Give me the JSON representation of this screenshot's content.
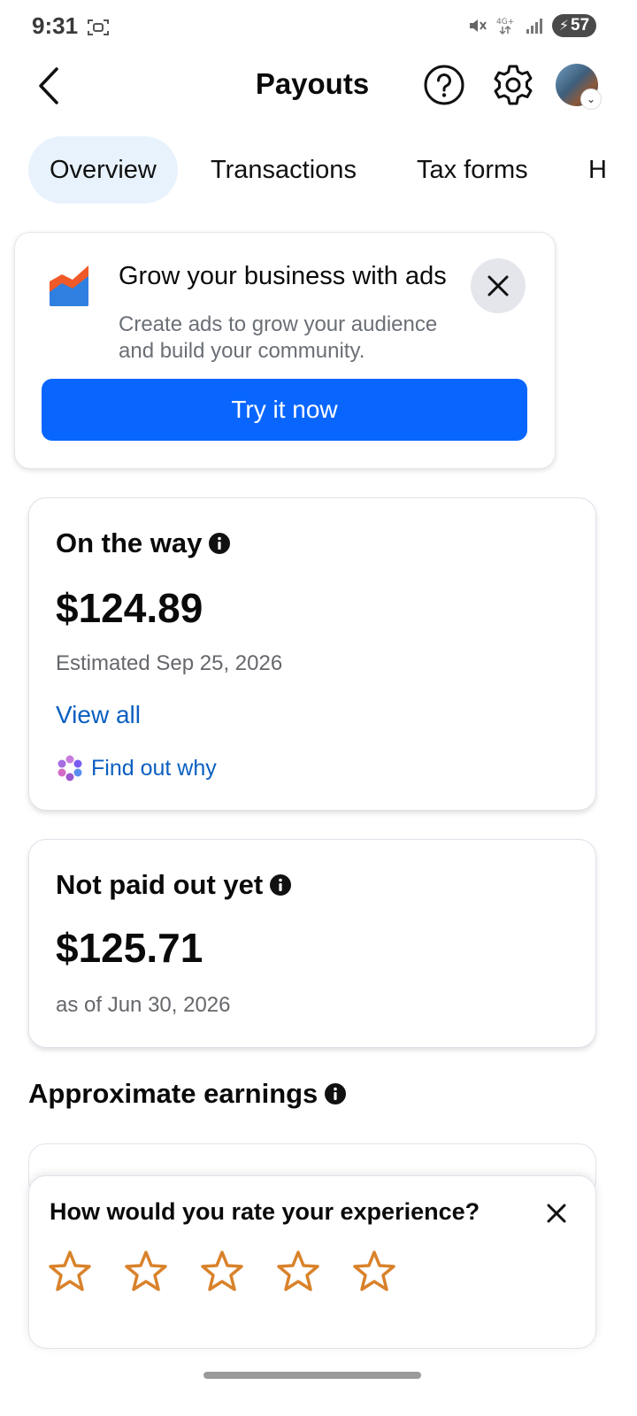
{
  "status_bar": {
    "time": "9:31",
    "battery": "57"
  },
  "header": {
    "title": "Payouts"
  },
  "tabs": [
    {
      "label": "Overview",
      "active": true
    },
    {
      "label": "Transactions",
      "active": false
    },
    {
      "label": "Tax forms",
      "active": false
    },
    {
      "label": "H",
      "active": false
    }
  ],
  "ad_card": {
    "title": "Grow your business with ads",
    "description": "Create ads to grow your audience and build your community.",
    "cta": "Try it now"
  },
  "on_the_way": {
    "title": "On the way",
    "amount": "$124.89",
    "estimated": "Estimated Sep 25, 2026",
    "view_all": "View all",
    "find_out_why": "Find out why"
  },
  "not_paid": {
    "title": "Not paid out yet",
    "amount": "$125.71",
    "as_of": "as of Jun 30, 2026"
  },
  "approximate_earnings": {
    "title": "Approximate earnings"
  },
  "rating": {
    "question": "How would you rate your experience?",
    "stars": 5,
    "selected": 0
  },
  "colors": {
    "accent": "#0866ff",
    "link": "#0a5fc0",
    "star": "#d9822b",
    "tab_active_bg": "#e8f2fd"
  }
}
